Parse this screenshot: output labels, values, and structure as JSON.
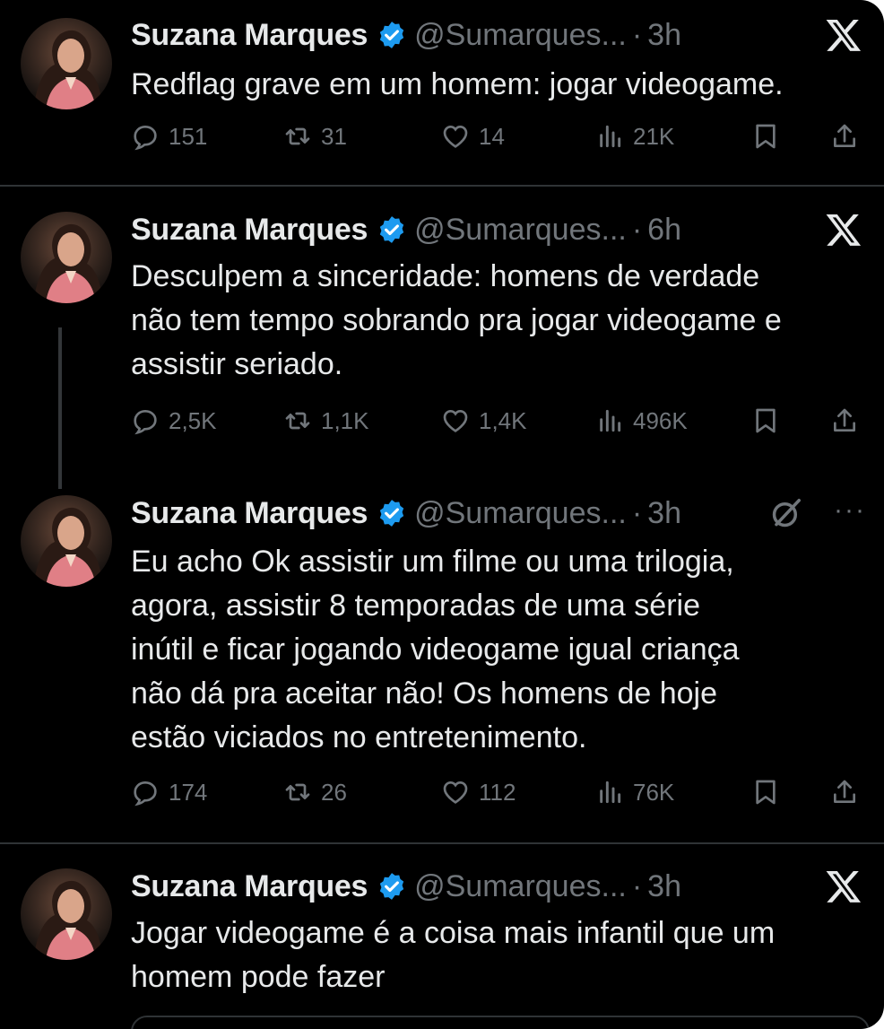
{
  "tweets": [
    {
      "name": "Suzana Marques",
      "handle": "@Sumarques...",
      "dot": "·",
      "time": "3h",
      "text": [
        "Redflag grave em um homem: jogar videogame."
      ],
      "replies": "151",
      "retweets": "31",
      "likes": "14",
      "views": "21K"
    },
    {
      "name": "Suzana Marques",
      "handle": "@Sumarques...",
      "dot": "·",
      "time": "6h",
      "text": [
        "Desculpem a sinceridade: homens de verdade",
        "não tem tempo sobrando pra jogar videogame e",
        "assistir seriado."
      ],
      "replies": "2,5K",
      "retweets": "1,1K",
      "likes": "1,4K",
      "views": "496K"
    },
    {
      "name": "Suzana Marques",
      "handle": "@Sumarques...",
      "dot": "·",
      "time": "3h",
      "text": [
        "Eu acho Ok assistir um filme ou uma trilogia,",
        "agora, assistir 8 temporadas de uma série",
        "inútil e ficar jogando videogame igual criança",
        "não dá pra aceitar não! Os homens de hoje",
        "estão viciados no entretenimento."
      ],
      "replies": "174",
      "retweets": "26",
      "likes": "112",
      "views": "76K"
    },
    {
      "name": "Suzana Marques",
      "handle": "@Sumarques...",
      "dot": "·",
      "time": "3h",
      "text": [
        "Jogar videogame é a coisa mais infantil que um",
        "homem pode fazer"
      ]
    }
  ],
  "more_label": "···",
  "colors": {
    "background": "#000000",
    "primary_text": "#e7e9ea",
    "secondary_text": "#71767b",
    "verified_blue": "#1d9bf0",
    "divider": "#2f3336"
  },
  "icons": [
    "reply-icon",
    "retweet-icon",
    "like-icon",
    "views-icon",
    "bookmark-icon",
    "share-icon",
    "x-logo-icon",
    "grok-icon",
    "verified-badge-icon"
  ]
}
